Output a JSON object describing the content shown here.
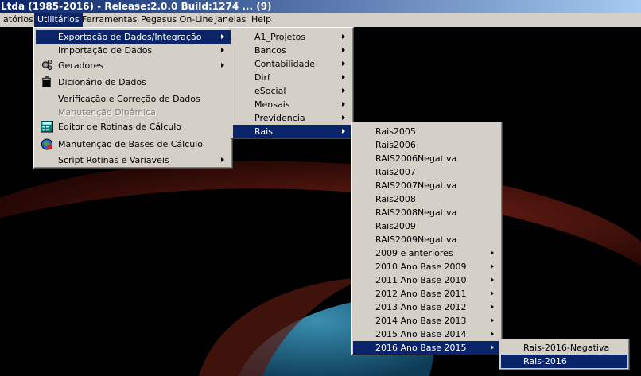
{
  "window": {
    "title": "Ltda (1985-2016) - Release:2.0.0  Build:1274 ... (9)"
  },
  "menubar": {
    "items": [
      {
        "label": "latórios"
      },
      {
        "label": "Utilitários"
      },
      {
        "label": "Ferramentas"
      },
      {
        "label": "Pegasus On-Line"
      },
      {
        "label": "Janelas"
      },
      {
        "label": "Help"
      }
    ]
  },
  "utilitarios_menu": {
    "items": [
      {
        "label": "Exportação de Dados/Integração",
        "icon": "",
        "submenu": true,
        "highlighted": true
      },
      {
        "label": "Importação de Dados",
        "icon": "",
        "submenu": true
      },
      {
        "label": "Geradores",
        "icon": "gears-icon",
        "submenu": true
      },
      {
        "label": "Dicionário de Dados",
        "icon": "book-icon"
      },
      {
        "label": "Verificação e Correção de Dados",
        "icon": ""
      },
      {
        "label": "Manutenção Dinâmica",
        "icon": "",
        "disabled": true
      },
      {
        "label": "Editor de Rotinas de Cálculo",
        "icon": "calculator-editor-icon"
      },
      {
        "label": "Manutenção de Bases de Cálculo",
        "icon": "globe-database-icon"
      },
      {
        "label": "Script Rotinas e Variaveis",
        "icon": "",
        "submenu": true
      }
    ]
  },
  "exportacao_menu": {
    "items": [
      {
        "label": "A1_Projetos"
      },
      {
        "label": "Bancos"
      },
      {
        "label": "Contabilidade"
      },
      {
        "label": "Dirf"
      },
      {
        "label": "eSocial"
      },
      {
        "label": "Mensais"
      },
      {
        "label": "Previdencia"
      },
      {
        "label": "Rais",
        "highlighted": true
      }
    ]
  },
  "rais_menu": {
    "items": [
      {
        "label": "Rais2005"
      },
      {
        "label": "Rais2006"
      },
      {
        "label": "RAIS2006Negativa"
      },
      {
        "label": "Rais2007"
      },
      {
        "label": "RAIS2007Negativa"
      },
      {
        "label": "Rais2008"
      },
      {
        "label": "RAIS2008Negativa"
      },
      {
        "label": "Rais2009"
      },
      {
        "label": "RAIS2009Negativa"
      },
      {
        "label": "2009 e anteriores",
        "submenu": true
      },
      {
        "label": "2010 Ano Base 2009",
        "submenu": true
      },
      {
        "label": "2011 Ano Base 2010",
        "submenu": true
      },
      {
        "label": "2012 Ano Base 2011",
        "submenu": true
      },
      {
        "label": "2013 Ano Base 2012",
        "submenu": true
      },
      {
        "label": "2014 Ano Base 2013",
        "submenu": true
      },
      {
        "label": "2015 Ano Base 2014",
        "submenu": true
      },
      {
        "label": "2016 Ano Base 2015",
        "submenu": true,
        "highlighted": true
      }
    ]
  },
  "ano_base_2015_menu": {
    "items": [
      {
        "label": "Rais-2016-Negativa"
      },
      {
        "label": "Rais-2016",
        "highlighted": true
      }
    ]
  },
  "colors": {
    "highlight": "#0a246a",
    "menu_bg": "#d4d0c8",
    "disabled": "#808080"
  }
}
